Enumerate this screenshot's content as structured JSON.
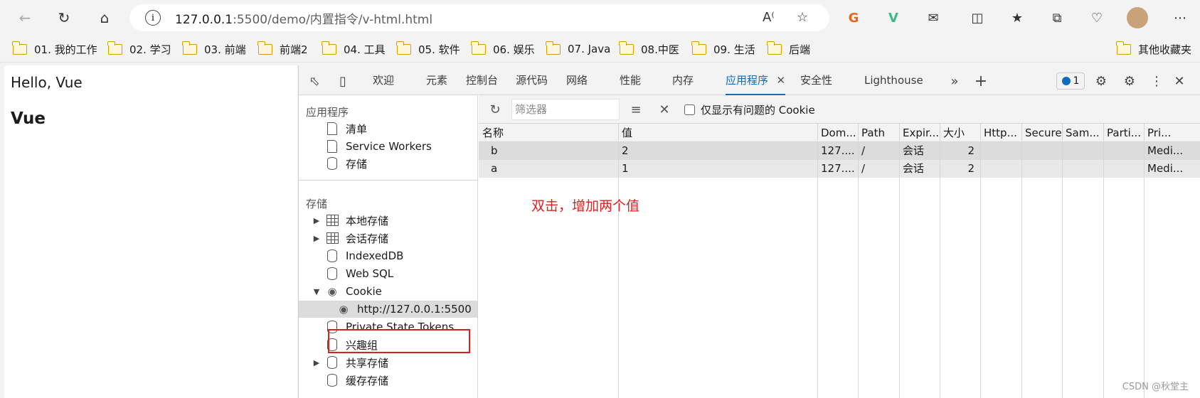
{
  "browser": {
    "url_host": "127.0.0.1",
    "url_rest": ":5500/demo/内置指令/v-html.html"
  },
  "bookmarks": [
    "01. 我的工作",
    "02. 学习",
    "03. 前端",
    "前端2",
    "04. 工具",
    "05. 软件",
    "06. 娱乐",
    "07. Java",
    "08.中医",
    "09. 生活",
    "后端",
    "其他收藏夹"
  ],
  "page": {
    "hello": "Hello, Vue",
    "heading": "Vue"
  },
  "devtools": {
    "tabs": [
      "欢迎",
      "元素",
      "控制台",
      "源代码",
      "网络",
      "性能",
      "内存",
      "应用程序",
      "安全性",
      "Lighthouse"
    ],
    "active_tab": "应用程序",
    "issue_count": "1",
    "sidebar": {
      "app_section": "应用程序",
      "app_items": [
        "清单",
        "Service Workers",
        "存储"
      ],
      "storage_section": "存储",
      "storage_items": [
        "本地存储",
        "会话存储",
        "IndexedDB",
        "Web SQL",
        "Cookie",
        "http://127.0.0.1:5500",
        "Private State Tokens",
        "兴趣组",
        "共享存储",
        "缓存存储"
      ]
    },
    "filter": {
      "placeholder": "筛选器",
      "only_issues_label": "仅显示有问题的 Cookie"
    },
    "table": {
      "columns": [
        "名称",
        "值",
        "Dom...",
        "Path",
        "Expir...",
        "大小",
        "Http...",
        "Secure",
        "Sam...",
        "Parti...",
        "Pri..."
      ],
      "rows": [
        [
          "b",
          "2",
          "127....",
          "/",
          "会话",
          "2",
          "",
          "",
          "",
          "",
          "Medi..."
        ],
        [
          "a",
          "1",
          "127....",
          "/",
          "会话",
          "2",
          "",
          "",
          "",
          "",
          "Medi..."
        ]
      ]
    }
  },
  "annotation": "双击，增加两个值",
  "watermark": "CSDN @秋堂主",
  "colors": {
    "accent": "#0f6cbd",
    "annotation_red": "#e0201e",
    "folder": "#d79b00"
  }
}
